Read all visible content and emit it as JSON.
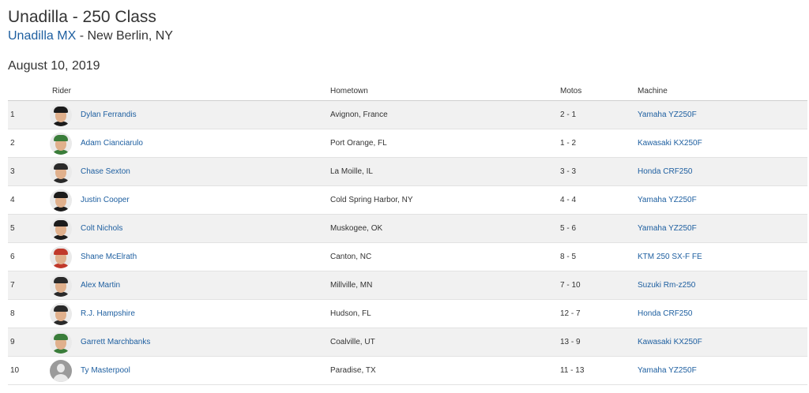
{
  "page": {
    "title": "Unadilla - 250 Class",
    "track_link": "Unadilla MX",
    "location": " - New Berlin, NY",
    "date": "August 10, 2019"
  },
  "table": {
    "headers": {
      "position": "",
      "rider": "Rider",
      "hometown": "Hometown",
      "motos": "Motos",
      "machine": "Machine"
    },
    "rows": [
      {
        "pos": "1",
        "rider": "Dylan Ferrandis",
        "hometown": "Avignon, France",
        "motos": "2 - 1",
        "machine": "Yamaha YZ250F",
        "avatar": "rider-photo",
        "accent": "#1b1b1b"
      },
      {
        "pos": "2",
        "rider": "Adam Cianciarulo",
        "hometown": "Port Orange, FL",
        "motos": "1 - 2",
        "machine": "Kawasaki KX250F",
        "avatar": "rider-photo",
        "accent": "#3a7d3a"
      },
      {
        "pos": "3",
        "rider": "Chase Sexton",
        "hometown": "La Moille, IL",
        "motos": "3 - 3",
        "machine": "Honda CRF250",
        "avatar": "rider-photo",
        "accent": "#2a2a2a"
      },
      {
        "pos": "4",
        "rider": "Justin Cooper",
        "hometown": "Cold Spring Harbor, NY",
        "motos": "4 - 4",
        "machine": "Yamaha YZ250F",
        "avatar": "rider-photo",
        "accent": "#1b1b1b"
      },
      {
        "pos": "5",
        "rider": "Colt Nichols",
        "hometown": "Muskogee, OK",
        "motos": "5 - 6",
        "machine": "Yamaha YZ250F",
        "avatar": "rider-photo",
        "accent": "#1b1b1b"
      },
      {
        "pos": "6",
        "rider": "Shane McElrath",
        "hometown": "Canton, NC",
        "motos": "8 - 5",
        "machine": "KTM 250 SX-F FE",
        "avatar": "rider-photo",
        "accent": "#c0392b"
      },
      {
        "pos": "7",
        "rider": "Alex Martin",
        "hometown": "Millville, MN",
        "motos": "7 - 10",
        "machine": "Suzuki Rm-z250",
        "avatar": "rider-photo",
        "accent": "#2a2a2a"
      },
      {
        "pos": "8",
        "rider": "R.J. Hampshire",
        "hometown": "Hudson, FL",
        "motos": "12 - 7",
        "machine": "Honda CRF250",
        "avatar": "rider-photo",
        "accent": "#2a2a2a"
      },
      {
        "pos": "9",
        "rider": "Garrett Marchbanks",
        "hometown": "Coalville, UT",
        "motos": "13 - 9",
        "machine": "Kawasaki KX250F",
        "avatar": "rider-photo",
        "accent": "#3a7d3a"
      },
      {
        "pos": "10",
        "rider": "Ty Masterpool",
        "hometown": "Paradise, TX",
        "motos": "11 - 13",
        "machine": "Yamaha YZ250F",
        "avatar": "generic-avatar",
        "accent": "#9a9a9a"
      }
    ]
  },
  "colors": {
    "link": "#1e5fa0",
    "row_alt": "#f1f1f1",
    "text": "#333333"
  }
}
